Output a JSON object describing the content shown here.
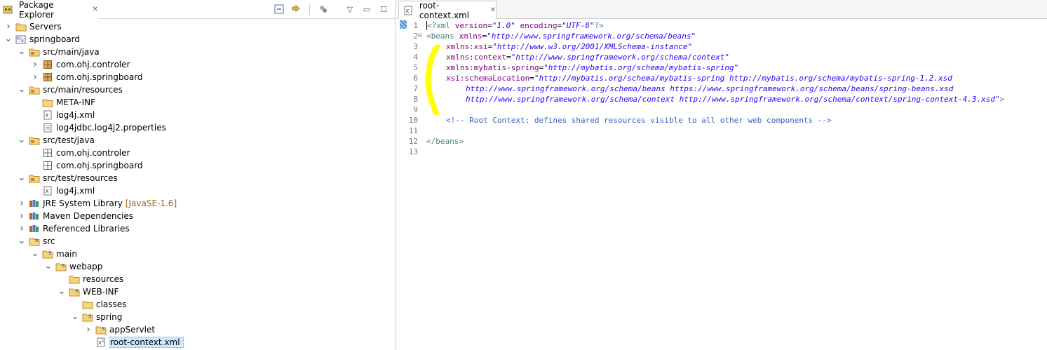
{
  "explorer": {
    "title": "Package Explorer",
    "tree": [
      {
        "label": "Servers",
        "icon": "folder-icon",
        "twisty": "collapsed",
        "depth": 0
      },
      {
        "label": "springboard",
        "icon": "maven-project-icon",
        "twisty": "expanded",
        "depth": 0
      },
      {
        "label": "src/main/java",
        "icon": "source-folder-icon",
        "twisty": "expanded",
        "depth": 1
      },
      {
        "label": "com.ohj.controler",
        "icon": "package-icon",
        "twisty": "collapsed",
        "depth": 2
      },
      {
        "label": "com.ohj.springboard",
        "icon": "package-icon",
        "twisty": "collapsed",
        "depth": 2
      },
      {
        "label": "src/main/resources",
        "icon": "source-folder-icon",
        "twisty": "expanded",
        "depth": 1
      },
      {
        "label": "META-INF",
        "icon": "folder-icon",
        "twisty": "none",
        "depth": 2
      },
      {
        "label": "log4j.xml",
        "icon": "xml-file-icon",
        "twisty": "none",
        "depth": 2
      },
      {
        "label": "log4jdbc.log4j2.properties",
        "icon": "text-file-icon",
        "twisty": "none",
        "depth": 2
      },
      {
        "label": "src/test/java",
        "icon": "source-folder-icon",
        "twisty": "expanded",
        "depth": 1
      },
      {
        "label": "com.ohj.controler",
        "icon": "empty-package-icon",
        "twisty": "none",
        "depth": 2
      },
      {
        "label": "com.ohj.springboard",
        "icon": "empty-package-icon",
        "twisty": "none",
        "depth": 2
      },
      {
        "label": "src/test/resources",
        "icon": "source-folder-icon",
        "twisty": "expanded",
        "depth": 1
      },
      {
        "label": "log4j.xml",
        "icon": "xml-file-icon",
        "twisty": "none",
        "depth": 2
      },
      {
        "label": "JRE System Library",
        "decoration": "[JavaSE-1.6]",
        "icon": "library-icon",
        "twisty": "collapsed",
        "depth": 1
      },
      {
        "label": "Maven Dependencies",
        "icon": "library-icon",
        "twisty": "collapsed",
        "depth": 1
      },
      {
        "label": "Referenced Libraries",
        "icon": "library-icon",
        "twisty": "collapsed",
        "depth": 1
      },
      {
        "label": "src",
        "icon": "spring-folder-icon",
        "twisty": "expanded",
        "depth": 1
      },
      {
        "label": "main",
        "icon": "spring-folder-icon",
        "twisty": "expanded",
        "depth": 2
      },
      {
        "label": "webapp",
        "icon": "spring-folder-icon",
        "twisty": "expanded",
        "depth": 3
      },
      {
        "label": "resources",
        "icon": "folder-icon",
        "twisty": "none",
        "depth": 4
      },
      {
        "label": "WEB-INF",
        "icon": "spring-folder-icon",
        "twisty": "expanded",
        "depth": 4
      },
      {
        "label": "classes",
        "icon": "folder-icon",
        "twisty": "none",
        "depth": 5
      },
      {
        "label": "spring",
        "icon": "spring-folder-icon",
        "twisty": "expanded",
        "depth": 5
      },
      {
        "label": "appServlet",
        "icon": "spring-folder-icon",
        "twisty": "collapsed",
        "depth": 6
      },
      {
        "label": "root-context.xml",
        "icon": "spring-xml-file-icon",
        "twisty": "none",
        "depth": 6,
        "selected": true
      }
    ]
  },
  "editor": {
    "tab_title": "root-context.xml",
    "line_numbers": [
      "1",
      "2",
      "3",
      "4",
      "5",
      "6",
      "7",
      "8",
      "9",
      "10",
      "11",
      "12",
      "13"
    ],
    "code": {
      "l1": {
        "open": "<?xml ",
        "a1": "version",
        "v1": "\"1.0\"",
        "a2": "encoding",
        "v2": "\"UTF-8\"",
        "close": "?>"
      },
      "l2": {
        "open": "<beans ",
        "a": "xmlns",
        "v": "\"http://www.springframework.org/schema/beans\""
      },
      "l3": {
        "a": "xmlns:xsi",
        "v": "\"http://www.w3.org/2001/XMLSchema-instance\""
      },
      "l4": {
        "a": "xmlns:context",
        "v": "\"http://www.springframework.org/schema/context\""
      },
      "l5": {
        "a": "xmlns:mybatis-spring",
        "v": "\"http://mybatis.org/schema/mybatis-spring\""
      },
      "l6": {
        "a": "xsi:schemaLocation",
        "v": "\"http://mybatis.org/schema/mybatis-spring http://mybatis.org/schema/mybatis-spring-1.2.xsd"
      },
      "l7": {
        "v": "http://www.springframework.org/schema/beans https://www.springframework.org/schema/beans/spring-beans.xsd"
      },
      "l8": {
        "v": "http://www.springframework.org/schema/context http://www.springframework.org/schema/context/spring-context-4.3.xsd\"",
        "close": ">"
      },
      "l10": {
        "comment": "<!-- Root Context: defines shared resources visible to all other web components -->"
      },
      "l12": {
        "close_tag": "</beans>"
      }
    }
  },
  "colors": {
    "highlight_mark": "#ffff00",
    "selection": "#cde8ff"
  }
}
